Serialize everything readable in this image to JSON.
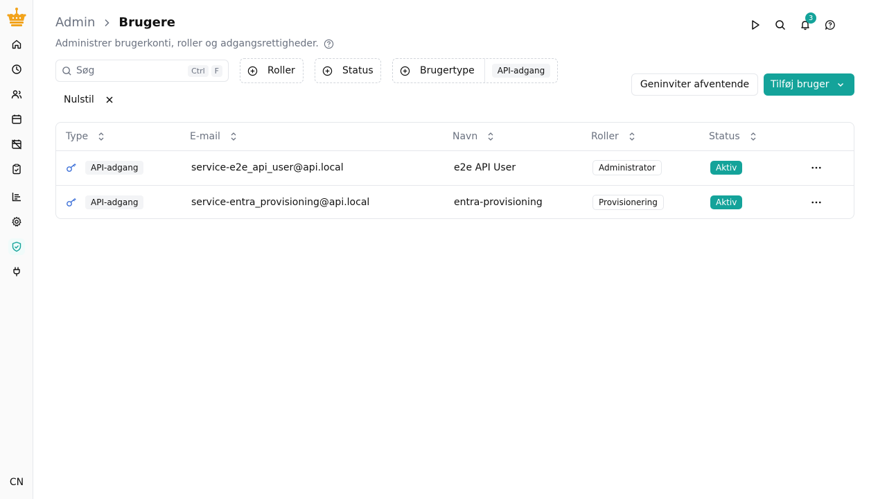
{
  "colors": {
    "accent": "#14a39a",
    "logo": "#f2a31b",
    "key_icon": "#3b6fd8",
    "muted": "#6b7280",
    "border": "#e5e7eb"
  },
  "sidebar": {
    "items": [
      {
        "name": "home",
        "icon": "home-icon"
      },
      {
        "name": "history",
        "icon": "clock-icon"
      },
      {
        "name": "users",
        "icon": "users-icon"
      },
      {
        "name": "calendar",
        "icon": "calendar-icon"
      },
      {
        "name": "calendar-off",
        "icon": "calendar-off-icon"
      },
      {
        "name": "clipboard",
        "icon": "clipboard-check-icon"
      },
      {
        "name": "reports",
        "icon": "chart-icon"
      },
      {
        "name": "settings",
        "icon": "gear-icon"
      },
      {
        "name": "admin",
        "icon": "shield-check-icon",
        "active": true
      },
      {
        "name": "integrations",
        "icon": "plug-icon"
      }
    ],
    "avatar_initials": "CN"
  },
  "header": {
    "breadcrumb_parent": "Admin",
    "breadcrumb_current": "Brugere",
    "subtitle": "Administrer brugerkonti, roller og adgangsrettigheder.",
    "notification_count": "3"
  },
  "filters": {
    "search_placeholder": "Søg",
    "search_value": "",
    "kbd_ctrl": "Ctrl",
    "kbd_f": "F",
    "roles_label": "Roller",
    "status_label": "Status",
    "usertype_label": "Brugertype",
    "usertype_chip": "API-adgang",
    "reset_label": "Nulstil"
  },
  "actions": {
    "reinvite_label": "Geninviter afventende",
    "add_user_label": "Tilføj bruger"
  },
  "table": {
    "headers": {
      "type": "Type",
      "email": "E-mail",
      "name": "Navn",
      "roles": "Roller",
      "status": "Status"
    },
    "rows": [
      {
        "type": "API-adgang",
        "email": "service-e2e_api_user@api.local",
        "name": "e2e API User",
        "role": "Administrator",
        "status": "Aktiv"
      },
      {
        "type": "API-adgang",
        "email": "service-entra_provisioning@api.local",
        "name": "entra-provisioning",
        "role": "Provisionering",
        "status": "Aktiv"
      }
    ]
  }
}
